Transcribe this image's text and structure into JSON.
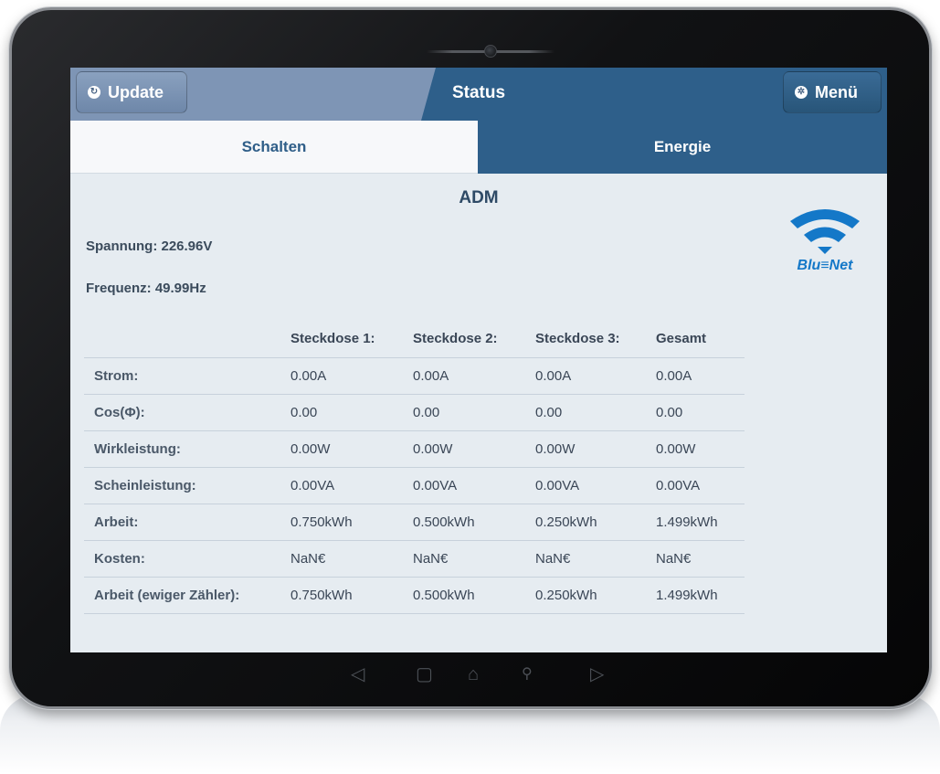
{
  "header": {
    "update_label": "Update",
    "title": "Status",
    "menu_label": "Menü"
  },
  "tabs": [
    {
      "label": "Schalten",
      "active": false
    },
    {
      "label": "Energie",
      "active": true
    }
  ],
  "device": {
    "name": "ADM",
    "spannung": "Spannung: 226.96V",
    "frequenz": "Frequenz: 49.99Hz"
  },
  "logo": {
    "text": "Blu≡Net",
    "icon": "wifi-icon",
    "color": "#1478c8"
  },
  "table": {
    "columns": [
      "",
      "Steckdose 1:",
      "Steckdose 2:",
      "Steckdose 3:",
      "Gesamt"
    ],
    "rows": [
      {
        "label": "Strom:",
        "values": [
          "0.00A",
          "0.00A",
          "0.00A",
          "0.00A"
        ]
      },
      {
        "label": "Cos(Φ):",
        "values": [
          "0.00",
          "0.00",
          "0.00",
          "0.00"
        ]
      },
      {
        "label": "Wirkleistung:",
        "values": [
          "0.00W",
          "0.00W",
          "0.00W",
          "0.00W"
        ]
      },
      {
        "label": "Scheinleistung:",
        "values": [
          "0.00VA",
          "0.00VA",
          "0.00VA",
          "0.00VA"
        ]
      },
      {
        "label": "Arbeit:",
        "values": [
          "0.750kWh",
          "0.500kWh",
          "0.250kWh",
          "1.499kWh"
        ]
      },
      {
        "label": "Kosten:",
        "values": [
          "NaN€",
          "NaN€",
          "NaN€",
          "NaN€"
        ]
      },
      {
        "label": "Arbeit (ewiger Zähler):",
        "values": [
          "0.750kWh",
          "0.500kWh",
          "0.250kWh",
          "1.499kWh"
        ]
      }
    ]
  },
  "colors": {
    "header_blue": "#2e5f8a",
    "header_light": "#7e95b5",
    "screen_bg": "#e6ecf1",
    "text": "#3a4656"
  },
  "nav_icons": [
    "back-icon",
    "recent-apps-icon",
    "home-icon",
    "search-icon",
    "forward-icon"
  ]
}
